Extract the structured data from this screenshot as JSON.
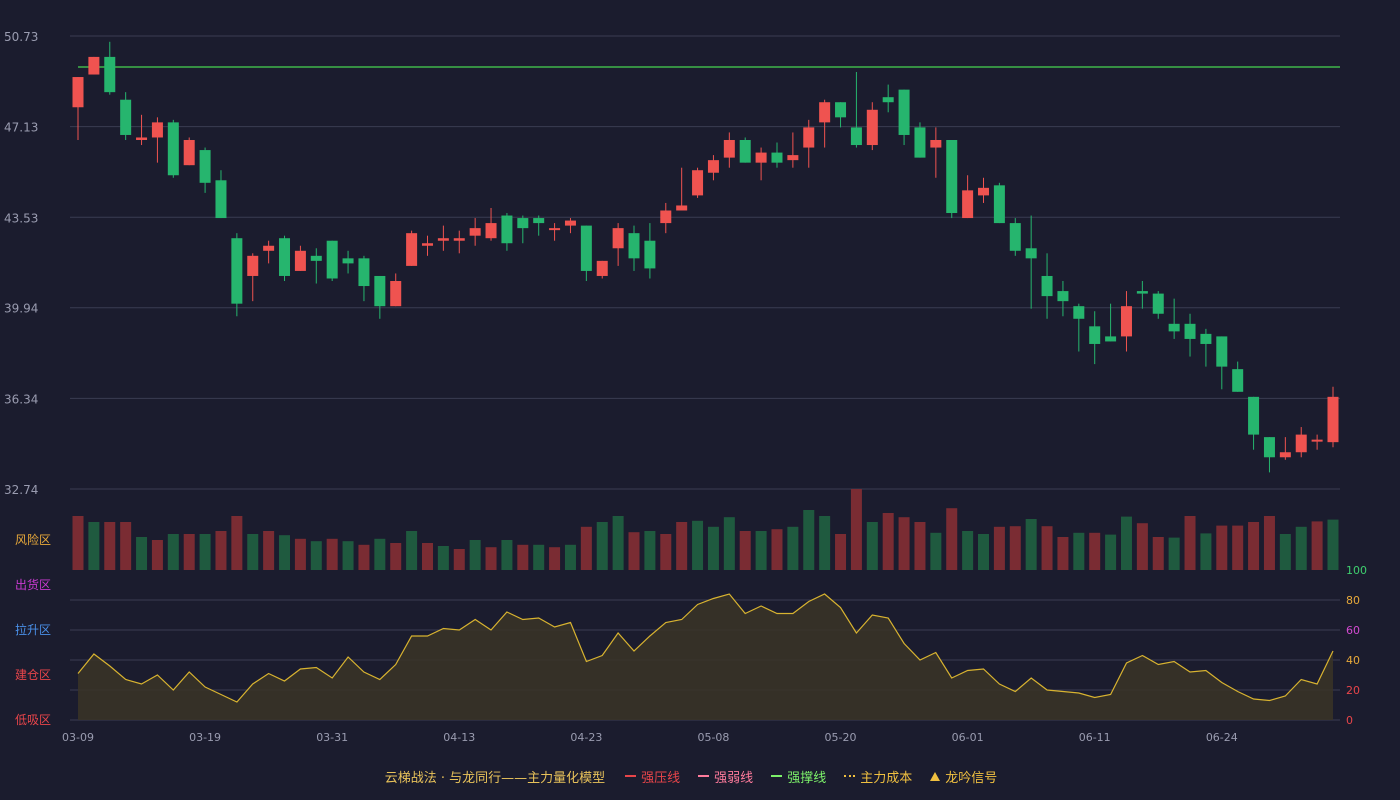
{
  "chart_data": [
    {
      "type": "candlestick",
      "title": "",
      "price_axis": {
        "ticks": [
          "50.73",
          "47.13",
          "43.53",
          "39.94",
          "36.34",
          "32.74"
        ],
        "range": [
          32.74,
          50.73
        ]
      },
      "reference_line": {
        "value": 49.5,
        "color": "#3fb54a"
      },
      "dates": [
        "03-09",
        "03-19",
        "03-31",
        "04-13",
        "04-23",
        "05-08",
        "05-20",
        "06-01",
        "06-11",
        "06-24"
      ],
      "candles": [
        [
          47.9,
          49.1,
          49.1,
          46.6
        ],
        [
          49.2,
          49.9,
          49.9,
          49.2
        ],
        [
          49.9,
          48.5,
          50.5,
          48.4
        ],
        [
          48.2,
          46.8,
          48.5,
          46.6
        ],
        [
          46.6,
          46.7,
          47.6,
          46.4
        ],
        [
          46.7,
          47.3,
          47.5,
          45.7
        ],
        [
          47.3,
          45.2,
          47.4,
          45.1
        ],
        [
          45.6,
          46.6,
          46.7,
          45.6
        ],
        [
          46.2,
          44.9,
          46.3,
          44.5
        ],
        [
          45.0,
          43.5,
          45.4,
          43.5
        ],
        [
          42.7,
          40.1,
          42.9,
          39.6
        ],
        [
          41.2,
          42.0,
          42.1,
          40.2
        ],
        [
          42.2,
          42.4,
          42.6,
          41.7
        ],
        [
          42.7,
          41.2,
          42.8,
          41.0
        ],
        [
          41.4,
          42.2,
          42.4,
          41.4
        ],
        [
          42.0,
          41.8,
          42.3,
          40.9
        ],
        [
          42.6,
          41.1,
          42.6,
          41.0
        ],
        [
          41.9,
          41.7,
          42.2,
          41.3
        ],
        [
          41.9,
          40.8,
          42.0,
          40.2
        ],
        [
          41.2,
          40.0,
          41.2,
          39.5
        ],
        [
          40.0,
          41.0,
          41.3,
          40.0
        ],
        [
          41.6,
          42.9,
          43.0,
          41.6
        ],
        [
          42.4,
          42.5,
          42.8,
          42.0
        ],
        [
          42.6,
          42.7,
          43.2,
          42.2
        ],
        [
          42.6,
          42.7,
          43.0,
          42.1
        ],
        [
          42.8,
          43.1,
          43.5,
          42.4
        ],
        [
          42.7,
          43.3,
          43.9,
          42.6
        ],
        [
          43.6,
          42.5,
          43.7,
          42.2
        ],
        [
          43.5,
          43.1,
          43.6,
          42.5
        ],
        [
          43.5,
          43.3,
          43.6,
          42.8
        ],
        [
          43.1,
          43.1,
          43.3,
          42.6
        ],
        [
          43.2,
          43.4,
          43.5,
          42.9
        ],
        [
          43.2,
          41.4,
          43.2,
          41.0
        ],
        [
          41.2,
          41.8,
          41.8,
          41.1
        ],
        [
          42.3,
          43.1,
          43.3,
          41.6
        ],
        [
          42.9,
          41.9,
          43.2,
          41.4
        ],
        [
          42.6,
          41.5,
          43.3,
          41.1
        ],
        [
          43.3,
          43.8,
          44.1,
          42.9
        ],
        [
          43.8,
          44.0,
          45.5,
          43.8
        ],
        [
          44.4,
          45.4,
          45.5,
          44.3
        ],
        [
          45.3,
          45.8,
          46.0,
          45.0
        ],
        [
          45.9,
          46.6,
          46.9,
          45.5
        ],
        [
          46.6,
          45.7,
          46.7,
          45.7
        ],
        [
          45.7,
          46.1,
          46.3,
          45.0
        ],
        [
          46.1,
          45.7,
          46.5,
          45.5
        ],
        [
          45.8,
          46.0,
          46.9,
          45.5
        ],
        [
          46.3,
          47.1,
          47.4,
          45.5
        ],
        [
          47.3,
          48.1,
          48.2,
          46.3
        ],
        [
          48.1,
          47.5,
          48.1,
          47.1
        ],
        [
          47.1,
          46.4,
          49.3,
          46.3
        ],
        [
          46.4,
          47.8,
          48.1,
          46.2
        ],
        [
          48.3,
          48.1,
          48.8,
          47.7
        ],
        [
          48.6,
          46.8,
          48.6,
          46.4
        ],
        [
          47.1,
          45.9,
          47.3,
          45.9
        ],
        [
          46.3,
          46.6,
          47.1,
          45.1
        ],
        [
          46.6,
          43.7,
          46.6,
          43.5
        ],
        [
          43.5,
          44.6,
          45.2,
          43.5
        ],
        [
          44.4,
          44.7,
          45.1,
          44.1
        ],
        [
          44.8,
          43.3,
          44.9,
          43.3
        ],
        [
          43.3,
          42.2,
          43.5,
          42.0
        ],
        [
          42.3,
          41.9,
          43.6,
          39.9
        ],
        [
          41.2,
          40.4,
          42.1,
          39.5
        ],
        [
          40.6,
          40.2,
          41.0,
          39.6
        ],
        [
          40.0,
          39.5,
          40.1,
          38.2
        ],
        [
          39.2,
          38.5,
          39.8,
          37.7
        ],
        [
          38.8,
          38.6,
          40.1,
          38.6
        ],
        [
          38.8,
          40.0,
          40.6,
          38.2
        ],
        [
          40.6,
          40.5,
          41.0,
          39.9
        ],
        [
          40.5,
          39.7,
          40.6,
          39.5
        ],
        [
          39.3,
          39.0,
          40.3,
          38.7
        ],
        [
          39.3,
          38.7,
          39.7,
          38.0
        ],
        [
          38.9,
          38.5,
          39.1,
          37.6
        ],
        [
          38.8,
          37.6,
          38.8,
          36.7
        ],
        [
          37.5,
          36.6,
          37.8,
          36.6
        ],
        [
          36.4,
          34.9,
          36.4,
          34.3
        ],
        [
          34.8,
          34.0,
          34.8,
          33.4
        ],
        [
          34.0,
          34.2,
          34.8,
          33.9
        ],
        [
          34.2,
          34.9,
          35.2,
          34.0
        ],
        [
          34.7,
          34.7,
          34.9,
          34.3
        ],
        [
          34.6,
          36.4,
          36.8,
          34.4
        ]
      ],
      "volume": [
        [
          0.9,
          "up"
        ],
        [
          0.8,
          "down"
        ],
        [
          0.8,
          "up"
        ],
        [
          0.8,
          "up"
        ],
        [
          0.55,
          "down"
        ],
        [
          0.5,
          "up"
        ],
        [
          0.6,
          "down"
        ],
        [
          0.6,
          "up"
        ],
        [
          0.6,
          "down"
        ],
        [
          0.65,
          "up"
        ],
        [
          0.9,
          "up"
        ],
        [
          0.6,
          "down"
        ],
        [
          0.65,
          "up"
        ],
        [
          0.58,
          "down"
        ],
        [
          0.52,
          "up"
        ],
        [
          0.48,
          "down"
        ],
        [
          0.52,
          "up"
        ],
        [
          0.48,
          "down"
        ],
        [
          0.42,
          "up"
        ],
        [
          0.52,
          "down"
        ],
        [
          0.45,
          "up"
        ],
        [
          0.65,
          "down"
        ],
        [
          0.45,
          "up"
        ],
        [
          0.4,
          "down"
        ],
        [
          0.35,
          "up"
        ],
        [
          0.5,
          "down"
        ],
        [
          0.38,
          "up"
        ],
        [
          0.5,
          "down"
        ],
        [
          0.42,
          "up"
        ],
        [
          0.42,
          "down"
        ],
        [
          0.38,
          "up"
        ],
        [
          0.42,
          "down"
        ],
        [
          0.72,
          "up"
        ],
        [
          0.8,
          "down"
        ],
        [
          0.9,
          "down"
        ],
        [
          0.63,
          "up"
        ],
        [
          0.65,
          "down"
        ],
        [
          0.6,
          "up"
        ],
        [
          0.8,
          "up"
        ],
        [
          0.82,
          "down"
        ],
        [
          0.72,
          "down"
        ],
        [
          0.88,
          "down"
        ],
        [
          0.65,
          "up"
        ],
        [
          0.65,
          "down"
        ],
        [
          0.68,
          "up"
        ],
        [
          0.72,
          "down"
        ],
        [
          1.0,
          "down"
        ],
        [
          0.9,
          "down"
        ],
        [
          0.6,
          "up"
        ],
        [
          1.35,
          "up"
        ],
        [
          0.8,
          "down"
        ],
        [
          0.95,
          "up"
        ],
        [
          0.88,
          "up"
        ],
        [
          0.8,
          "up"
        ],
        [
          0.62,
          "down"
        ],
        [
          1.03,
          "up"
        ],
        [
          0.65,
          "down"
        ],
        [
          0.6,
          "down"
        ],
        [
          0.72,
          "up"
        ],
        [
          0.73,
          "up"
        ],
        [
          0.85,
          "down"
        ],
        [
          0.73,
          "up"
        ],
        [
          0.55,
          "up"
        ],
        [
          0.62,
          "down"
        ],
        [
          0.62,
          "up"
        ],
        [
          0.59,
          "down"
        ],
        [
          0.89,
          "down"
        ],
        [
          0.78,
          "up"
        ],
        [
          0.55,
          "up"
        ],
        [
          0.54,
          "down"
        ],
        [
          0.9,
          "up"
        ],
        [
          0.61,
          "down"
        ],
        [
          0.74,
          "up"
        ],
        [
          0.74,
          "up"
        ],
        [
          0.8,
          "up"
        ],
        [
          0.9,
          "up"
        ],
        [
          0.6,
          "down"
        ],
        [
          0.72,
          "down"
        ],
        [
          0.81,
          "up"
        ],
        [
          0.84,
          "down"
        ]
      ],
      "oscillator": {
        "ticks": [
          "0",
          "20",
          "40",
          "60",
          "80",
          "100"
        ],
        "tick_colors": [
          "#e8454a",
          "#e8454a",
          "#e8a93a",
          "#d44ad1",
          "#e8a93a",
          "#3ecf6e"
        ],
        "zones": [
          "低吸区",
          "建仓区",
          "拉升区",
          "出货区",
          "风险区"
        ],
        "zone_colors": [
          "#e8454a",
          "#e8454a",
          "#4a90e8",
          "#c93ad1",
          "#e8a93a"
        ],
        "values": [
          31,
          44,
          36,
          27,
          24,
          30,
          20,
          32,
          22,
          17,
          12,
          24,
          31,
          26,
          34,
          35,
          28,
          42,
          32,
          27,
          37,
          56,
          56,
          61,
          60,
          67,
          60,
          72,
          67,
          68,
          62,
          65,
          39,
          43,
          58,
          46,
          56,
          65,
          67,
          77,
          81,
          84,
          71,
          76,
          71,
          71,
          79,
          84,
          75,
          58,
          70,
          68,
          51,
          40,
          45,
          28,
          33,
          34,
          24,
          19,
          28,
          20,
          19,
          18,
          15,
          17,
          38,
          43,
          37,
          39,
          32,
          33,
          25,
          19,
          14,
          13,
          16,
          27,
          24,
          46
        ]
      }
    }
  ],
  "legend": {
    "brand": "云梯战法 · 与龙同行——主力量化模型",
    "items": [
      {
        "label": "强压线",
        "color": "#e8454a",
        "style": "solid"
      },
      {
        "label": "强弱线",
        "color": "#ff7b9c",
        "style": "dash"
      },
      {
        "label": "强撑线",
        "color": "#7cf06a",
        "style": "solid"
      },
      {
        "label": "主力成本",
        "color": "#f0c040",
        "style": "dot"
      },
      {
        "label": "龙吟信号",
        "color": "#f0c040",
        "style": "triangle"
      }
    ]
  },
  "colors": {
    "up": "#ef5350",
    "down": "#26b56e",
    "up_vol": "#7a2c33",
    "down_vol": "#1f5a3f",
    "osc_line": "#d8b330",
    "grid": "#3b3d52",
    "axis_text": "#9a9cb0"
  }
}
